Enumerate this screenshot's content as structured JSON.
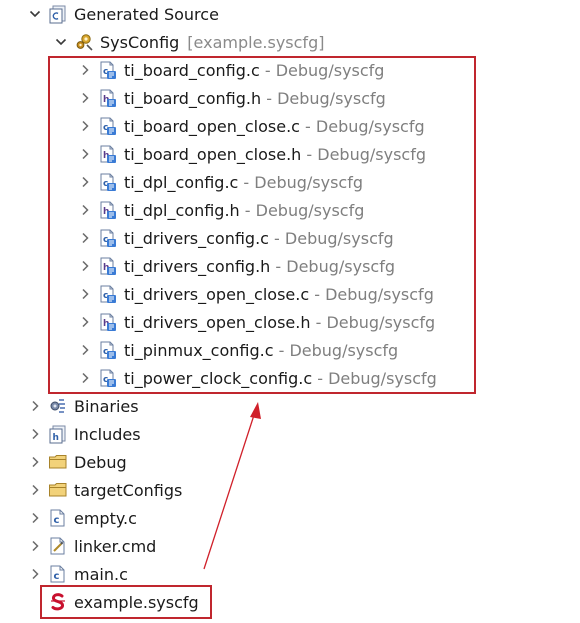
{
  "tree": {
    "generated_source": {
      "label": "Generated Source"
    },
    "sysconfig": {
      "label": "SysConfig",
      "suffix": "[example.syscfg]"
    },
    "generated_files": [
      {
        "name": "ti_board_config.c",
        "sep": " - ",
        "path": "Debug/syscfg",
        "kind": "c"
      },
      {
        "name": "ti_board_config.h",
        "sep": " - ",
        "path": "Debug/syscfg",
        "kind": "h"
      },
      {
        "name": "ti_board_open_close.c",
        "sep": " - ",
        "path": "Debug/syscfg",
        "kind": "c"
      },
      {
        "name": "ti_board_open_close.h",
        "sep": " - ",
        "path": "Debug/syscfg",
        "kind": "h"
      },
      {
        "name": "ti_dpl_config.c",
        "sep": " - ",
        "path": "Debug/syscfg",
        "kind": "c"
      },
      {
        "name": "ti_dpl_config.h",
        "sep": " - ",
        "path": "Debug/syscfg",
        "kind": "h"
      },
      {
        "name": "ti_drivers_config.c",
        "sep": " - ",
        "path": "Debug/syscfg",
        "kind": "c"
      },
      {
        "name": "ti_drivers_config.h",
        "sep": " - ",
        "path": "Debug/syscfg",
        "kind": "h"
      },
      {
        "name": "ti_drivers_open_close.c",
        "sep": " - ",
        "path": "Debug/syscfg",
        "kind": "c"
      },
      {
        "name": "ti_drivers_open_close.h",
        "sep": " - ",
        "path": "Debug/syscfg",
        "kind": "h"
      },
      {
        "name": "ti_pinmux_config.c",
        "sep": " - ",
        "path": "Debug/syscfg",
        "kind": "c"
      },
      {
        "name": "ti_power_clock_config.c",
        "sep": " - ",
        "path": "Debug/syscfg",
        "kind": "c"
      }
    ],
    "project_items": [
      {
        "label": "Binaries",
        "icon": "binaries-icon",
        "expandable": true
      },
      {
        "label": "Includes",
        "icon": "includes-icon",
        "expandable": true
      },
      {
        "label": "Debug",
        "icon": "folder-icon",
        "expandable": true
      },
      {
        "label": "targetConfigs",
        "icon": "folder-icon",
        "expandable": true
      },
      {
        "label": "empty.c",
        "icon": "c-file-icon",
        "expandable": true
      },
      {
        "label": "linker.cmd",
        "icon": "cmd-file-icon",
        "expandable": true
      },
      {
        "label": "main.c",
        "icon": "c-file-icon",
        "expandable": true
      },
      {
        "label": "example.syscfg",
        "icon": "syscfg-file-icon",
        "expandable": false
      }
    ]
  },
  "colors": {
    "highlight_border": "#c0262e",
    "arrow": "#d0202a",
    "path_text": "#7f7f7f"
  }
}
